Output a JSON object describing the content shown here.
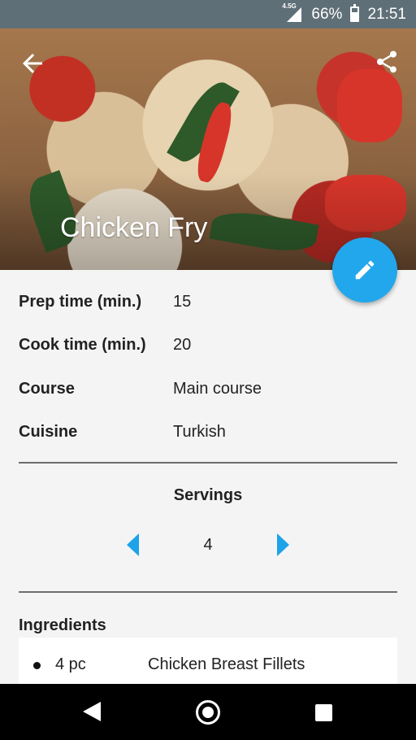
{
  "status_bar": {
    "network": "4.5G",
    "battery_percent": "66%",
    "battery_level": 0.66,
    "time": "21:51"
  },
  "recipe": {
    "title": "Chicken Fry"
  },
  "details": [
    {
      "label": "Prep time (min.)",
      "value": "15"
    },
    {
      "label": "Cook time (min.)",
      "value": "20"
    },
    {
      "label": "Course",
      "value": "Main course"
    },
    {
      "label": "Cuisine",
      "value": "Turkish"
    }
  ],
  "servings": {
    "label": "Servings",
    "value": "4"
  },
  "ingredients": {
    "title": "Ingredients",
    "items": [
      {
        "quantity": "4 pc",
        "name": "Chicken Breast Fillets"
      }
    ]
  },
  "colors": {
    "accent": "#22a7ec",
    "status_bar": "#5f6f78"
  },
  "icons": {
    "back": "arrow-left-icon",
    "share": "share-icon",
    "edit": "pencil-icon",
    "decrement": "triangle-left-icon",
    "increment": "triangle-right-icon"
  }
}
